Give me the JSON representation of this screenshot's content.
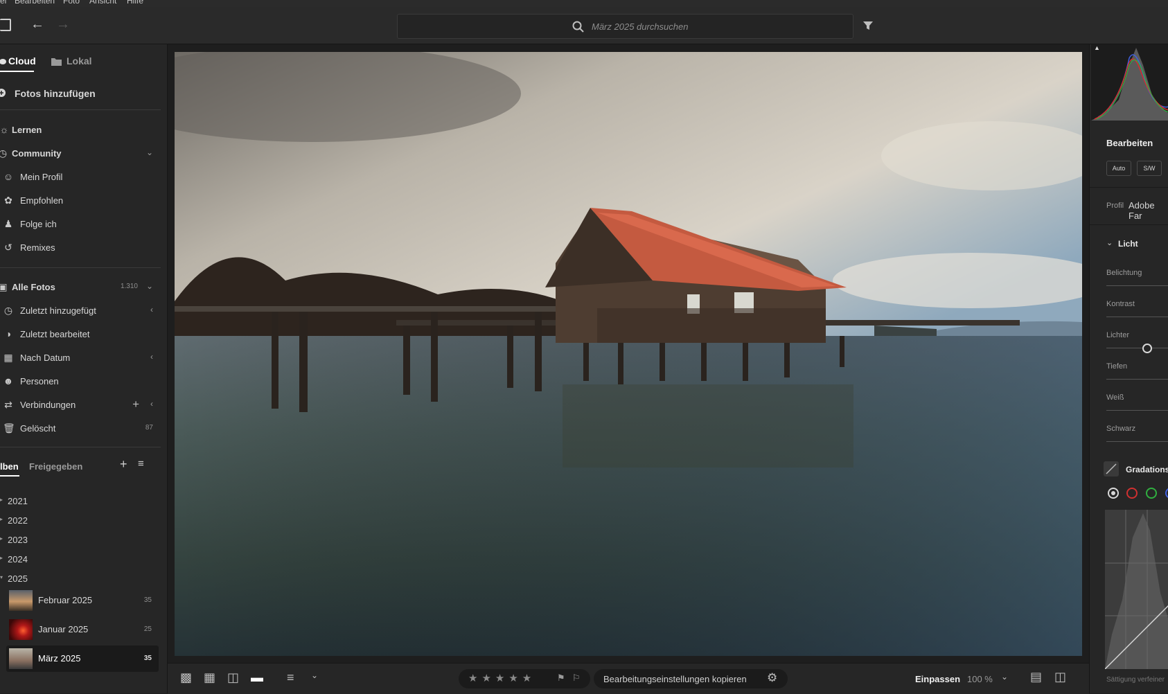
{
  "menu": [
    "el",
    "Bearbeiten",
    "Foto",
    "Ansicht",
    "Hilfe"
  ],
  "search": {
    "placeholder": "März 2025 durchsuchen"
  },
  "left": {
    "tabs": {
      "cloud": "Cloud",
      "local": "Lokal"
    },
    "add_photos": "Fotos hinzufügen",
    "learn": "Lernen",
    "community": "Community",
    "community_items": [
      "Mein Profil",
      "Empfohlen",
      "Folge ich",
      "Remixes"
    ],
    "all_photos": "Alle Fotos",
    "all_photos_count": "1.310",
    "lib_items": [
      "Zuletzt hinzugefügt",
      "Zuletzt bearbeitet",
      "Nach Datum",
      "Personen",
      "Verbindungen",
      "Gelöscht"
    ],
    "deleted_count": "87",
    "album_tabs": {
      "albums": "lben",
      "shared": "Freigegeben"
    },
    "years": [
      "2021",
      "2022",
      "2023",
      "2024",
      "2025"
    ],
    "albums": [
      {
        "name": "Februar 2025",
        "count": "35"
      },
      {
        "name": "Januar 2025",
        "count": "25"
      },
      {
        "name": "März 2025",
        "count": "35"
      }
    ]
  },
  "bottom": {
    "copy_settings": "Bearbeitungseinstellungen kopieren",
    "fit": "Einpassen",
    "zoom": "100 %"
  },
  "right": {
    "edit_title": "Bearbeiten",
    "auto": "Auto",
    "bw": "S/W",
    "profile_label": "Profil",
    "profile_value": "Adobe Far",
    "light": "Licht",
    "sliders": [
      "Belichtung",
      "Kontrast",
      "Lichter",
      "Tiefen",
      "Weiß",
      "Schwarz"
    ],
    "curve": "Gradations",
    "saturation": "Sättigung verfeiner"
  },
  "colors": {
    "accent": "#ffffff",
    "roof": "#c8553a",
    "red_channel": "#d03030",
    "green_channel": "#30b040",
    "blue_channel": "#4060e0"
  }
}
